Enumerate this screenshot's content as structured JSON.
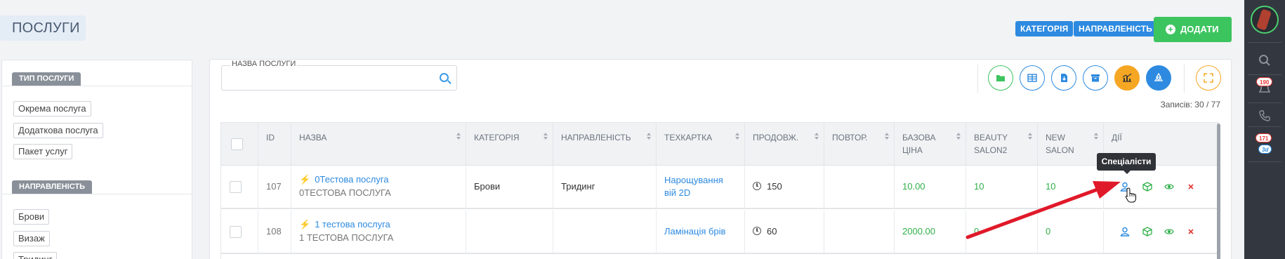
{
  "page": {
    "title": "ПОСЛУГИ"
  },
  "header": {
    "category_button": "КАТЕГОРІЯ",
    "direction_button": "НАПРАВЛЕНІСТЬ",
    "add_button": "ДОДАТИ"
  },
  "sidebar": {
    "service_type": {
      "title": "ТИП ПОСЛУГИ",
      "items": [
        "Окрема послуга",
        "Додаткова послуга",
        "Пакет услуг"
      ]
    },
    "direction": {
      "title": "НАПРАВЛЕНІСТЬ",
      "items": [
        "Брови",
        "Визаж",
        "Тридинг"
      ]
    }
  },
  "search": {
    "label": "НАЗВА ПОСЛУГИ",
    "value": ""
  },
  "records": "Записів: 30 / 77",
  "table": {
    "headers": {
      "id": "ID",
      "name": "НАЗВА",
      "category": "КАТЕГОРІЯ",
      "direction": "НАПРАВЛЕНІСТЬ",
      "techcard": "ТЕХКАРТКА",
      "duration": "ПРОДОВЖ.",
      "repeat": "ПОВТОР.",
      "base_price": "БАЗОВА ЦІНА",
      "salon1": "BEAUTY SALON2",
      "salon2": "NEW SALON",
      "actions": "ДІЇ"
    },
    "rows": [
      {
        "id": "107",
        "name": "0Тестова послуга",
        "subname": "0ТЕСТОВА ПОСЛУГА",
        "category": "Брови",
        "direction": "Тридинг",
        "techcard": "Нарощування вій 2D",
        "duration": "150",
        "repeat": "",
        "base_price": "10.00",
        "salon1": "10",
        "salon2": "10"
      },
      {
        "id": "108",
        "name": "1 тестова послуга",
        "subname": "1 ТЕСТОВА ПОСЛУГА",
        "category": "",
        "direction": "",
        "techcard": "Ламінація брів",
        "duration": "60",
        "repeat": "",
        "base_price": "2000.00",
        "salon1": "0",
        "salon2": "0"
      }
    ]
  },
  "tooltip": "Спеціалісти",
  "notifications": {
    "badge1": "190",
    "badge2": "171",
    "badge3": "3d"
  },
  "colors": {
    "accent_blue": "#2d8ae0",
    "green": "#3cc45f",
    "orange": "#f5a623",
    "red": "#e53935",
    "arrow": "#e0192a"
  }
}
